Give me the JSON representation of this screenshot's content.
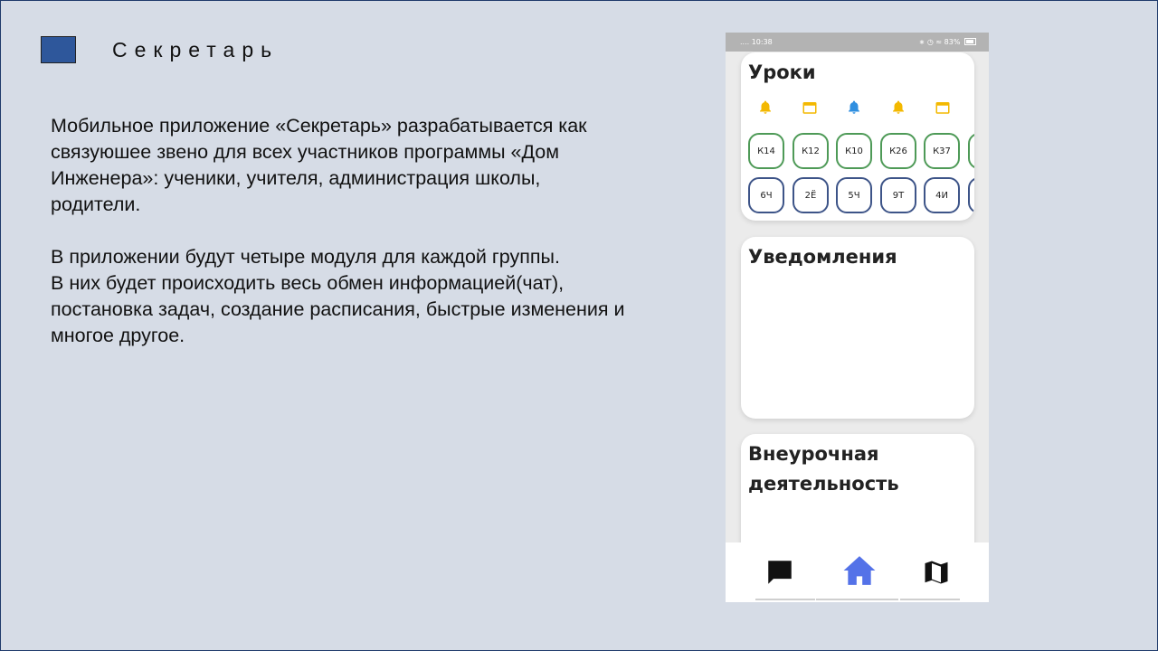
{
  "slide": {
    "title": "Секретарь",
    "accent_color": "#2e579b",
    "paragraphs": [
      "Мобильное приложение «Секретарь» разрабатывается как связуюшее звено для всех участников программы «Дом Инженера»: ученики, учителя, администрация школы, родители.",
      "В приложении будут четыре модуля для каждой группы.",
      "В них будет происходить весь обмен информацией(чат), постановка задач, создание расписания, быстрые изменения и многое другое."
    ]
  },
  "phone": {
    "status_bar": {
      "time": "10:38",
      "battery": "83%"
    },
    "lessons_card": {
      "title": "Уроки",
      "icons": [
        "bell-icon-yellow",
        "calendar-icon-yellow",
        "bell-icon-blue",
        "bell-icon-yellow",
        "calendar-icon-yellow"
      ],
      "rooms": [
        "К14",
        "К12",
        "К10",
        "К26",
        "К37",
        ""
      ],
      "classes": [
        "6Ч",
        "2Ё",
        "5Ч",
        "9Т",
        "4И",
        ""
      ]
    },
    "notices_card": {
      "title": "Уведомления"
    },
    "extra_card": {
      "title_line1": "Внеурочная",
      "title_line2": "деятельность"
    },
    "nav": {
      "items": [
        "chat-icon",
        "home-icon",
        "map-icon"
      ],
      "active": "home-icon",
      "active_color": "#5472e8"
    }
  }
}
